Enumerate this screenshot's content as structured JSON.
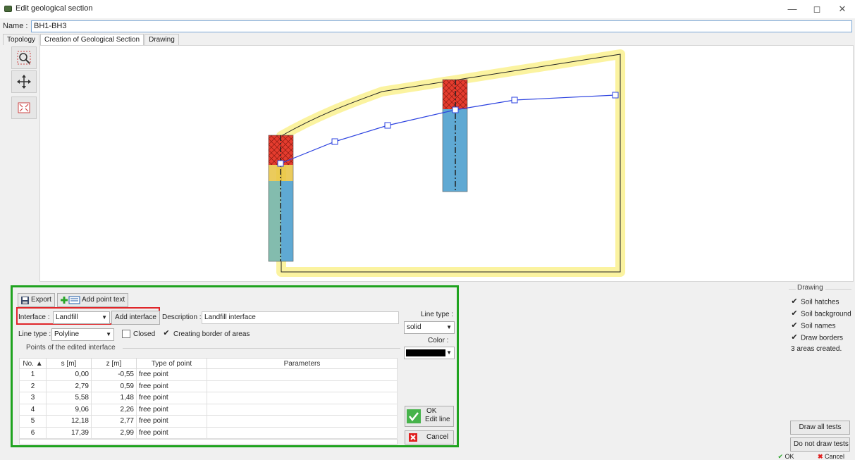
{
  "window": {
    "title": "Edit geological section",
    "minimize": "—",
    "maximize": "◻",
    "close": "✕"
  },
  "name_row": {
    "label": "Name :",
    "value": "BH1-BH3"
  },
  "tabs": [
    {
      "label": "Topology"
    },
    {
      "label": "Creation of Geological Section"
    },
    {
      "label": "Drawing"
    }
  ],
  "panel": {
    "export_label": "Export",
    "add_point_text_label": "Add point text",
    "interface_label": "Interface :",
    "interface_value": "Landfill",
    "add_interface_label": "Add interface",
    "description_label": "Description :",
    "description_value": "Landfill interface",
    "line_type_label": "Line type :",
    "line_type_value": "Polyline",
    "closed_label": "Closed",
    "closed_checked": false,
    "border_label": "Creating border of areas",
    "border_checked": true,
    "points_group_label": "Points of the edited interface",
    "right_line_type_label": "Line type :",
    "right_line_type_value": "solid",
    "color_label": "Color :",
    "color_value": "#000000",
    "ok_label": "OK",
    "edit_line_label": "Edit line",
    "cancel_label": "Cancel"
  },
  "table": {
    "headers": [
      "No.",
      "s [m]",
      "z [m]",
      "Type of point",
      "Parameters"
    ],
    "rows": [
      {
        "no": "1",
        "s": "0,00",
        "z": "-0,55",
        "type": "free point",
        "params": ""
      },
      {
        "no": "2",
        "s": "2,79",
        "z": "0,59",
        "type": "free point",
        "params": ""
      },
      {
        "no": "3",
        "s": "5,58",
        "z": "1,48",
        "type": "free point",
        "params": ""
      },
      {
        "no": "4",
        "s": "9,06",
        "z": "2,26",
        "type": "free point",
        "params": ""
      },
      {
        "no": "5",
        "s": "12,18",
        "z": "2,77",
        "type": "free point",
        "params": ""
      },
      {
        "no": "6",
        "s": "17,39",
        "z": "2,99",
        "type": "free point",
        "params": ""
      }
    ]
  },
  "drawing_options": {
    "group_label": "Drawing",
    "soil_hatches": "Soil hatches",
    "soil_background": "Soil background",
    "soil_names": "Soil names",
    "draw_borders": "Draw borders",
    "areas_created": "3 areas created.",
    "draw_all_tests": "Draw all tests",
    "do_not_draw_tests": "Do not draw tests"
  },
  "footer": {
    "ok_label": "OK",
    "cancel_label": "Cancel"
  },
  "colors": {
    "panel_border": "#1fa31f",
    "highlight": "#e0262a",
    "interface_line": "#2d43e0",
    "section_highlight": "#fbf3a0",
    "soil_red": "#e53c2e",
    "soil_blue": "#5fa9d3",
    "soil_yellow": "#e7c23f"
  },
  "icons": [
    "zoom-icon",
    "pan-icon",
    "fit-icon",
    "export-icon",
    "add-point-text-icon",
    "ok-check-icon",
    "cancel-x-icon"
  ]
}
